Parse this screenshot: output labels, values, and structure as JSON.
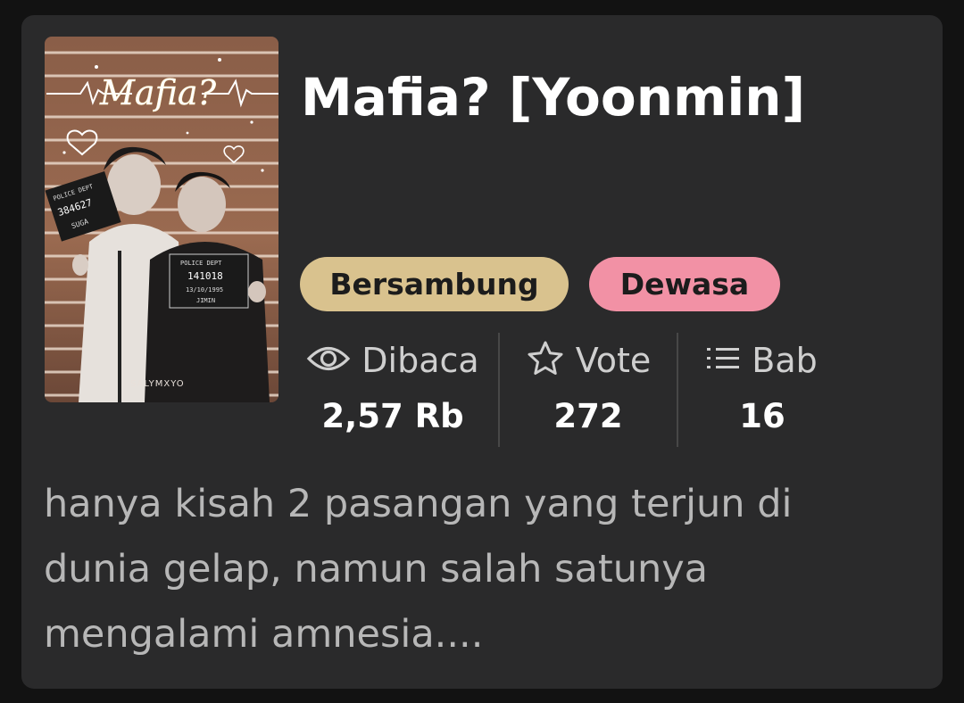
{
  "story": {
    "title": "Mafia? [Yoonmin]",
    "status_badge": "Bersambung",
    "rating_badge": "Dewasa",
    "cover": {
      "title_text": "Mafia?",
      "card_left_number": "384627",
      "card_left_name": "SUGA",
      "card_left_header": "POLICE DEPT",
      "card_right_header": "POLICE DEPT",
      "card_right_number": "141018",
      "card_right_date": "13/10/1995",
      "card_right_name": "JIMIN",
      "watermark": "SALYMXYO"
    },
    "stats": {
      "reads_label": "Dibaca",
      "reads_value": "2,57 Rb",
      "reads_icon": "eye-icon",
      "votes_label": "Vote",
      "votes_value": "272",
      "votes_icon": "star-outline-icon",
      "parts_label": "Bab",
      "parts_value": "16",
      "parts_icon": "list-icon"
    },
    "description": "hanya kisah 2 pasangan yang terjun di dunia gelap, namun salah satunya mengalami amnesia...."
  },
  "colors": {
    "card_background": "#2a2a2b",
    "page_background": "#121212",
    "status_badge": "#d9c28e",
    "rating_badge": "#f291a5",
    "title_text": "#ffffff",
    "description_text": "#b7b7b7"
  }
}
